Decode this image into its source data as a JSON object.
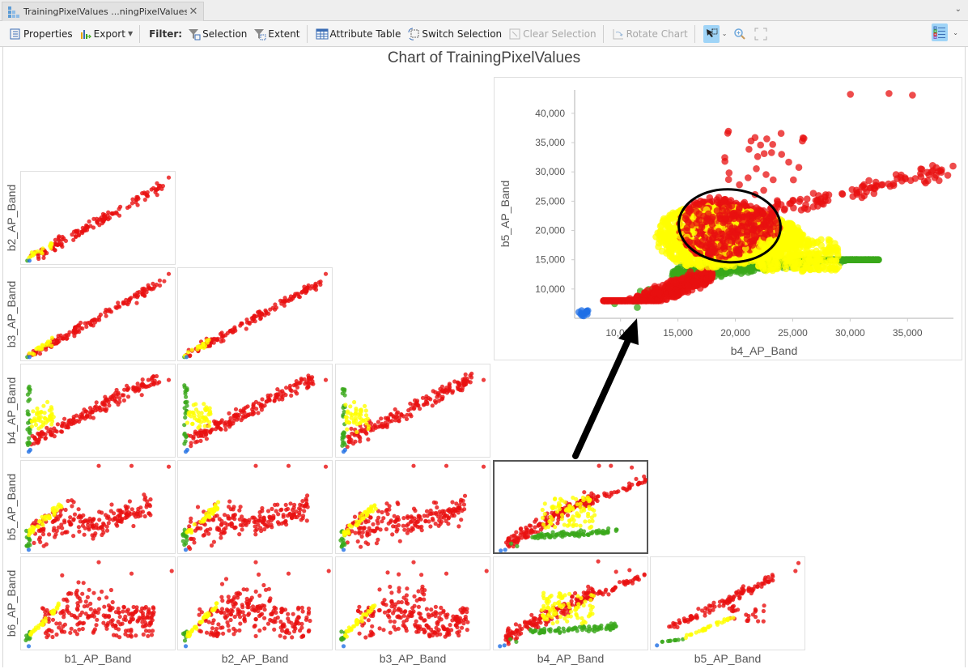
{
  "tab": {
    "label": "TrainingPixelValues ...ningPixelValues",
    "close": "✕"
  },
  "toolbar": {
    "properties": "Properties",
    "export": "Export",
    "filter_label": "Filter:",
    "selection": "Selection",
    "extent": "Extent",
    "attribute_table": "Attribute Table",
    "switch_selection": "Switch Selection",
    "clear_selection": "Clear Selection",
    "rotate_chart": "Rotate Chart"
  },
  "title": "Chart of TrainingPixelValues",
  "classes": [
    {
      "name": "class-blue",
      "color": "#1f6fe5"
    },
    {
      "name": "class-green",
      "color": "#3aa81a"
    },
    {
      "name": "class-yellow",
      "color": "#ffff00"
    },
    {
      "name": "class-red",
      "color": "#e81010"
    }
  ],
  "matrix": {
    "row_labels": [
      "b2_AP_Band",
      "b3_AP_Band",
      "b4_AP_Band",
      "b5_AP_Band",
      "b6_AP_Band"
    ],
    "col_labels": [
      "b1_AP_Band",
      "b2_AP_Band",
      "b3_AP_Band",
      "b4_AP_Band",
      "b5_AP_Band"
    ],
    "selected_cell": {
      "row": 3,
      "col": 3
    },
    "cells": [
      {
        "row": 0,
        "col": 0,
        "shape": "linear"
      },
      {
        "row": 1,
        "col": 0,
        "shape": "linear"
      },
      {
        "row": 1,
        "col": 1,
        "shape": "linear"
      },
      {
        "row": 2,
        "col": 0,
        "shape": "nir"
      },
      {
        "row": 2,
        "col": 1,
        "shape": "nir"
      },
      {
        "row": 2,
        "col": 2,
        "shape": "nir"
      },
      {
        "row": 3,
        "col": 0,
        "shape": "swir"
      },
      {
        "row": 3,
        "col": 1,
        "shape": "swir"
      },
      {
        "row": 3,
        "col": 2,
        "shape": "swir"
      },
      {
        "row": 3,
        "col": 3,
        "shape": "b4b5"
      },
      {
        "row": 4,
        "col": 0,
        "shape": "b6"
      },
      {
        "row": 4,
        "col": 1,
        "shape": "b6"
      },
      {
        "row": 4,
        "col": 2,
        "shape": "b6"
      },
      {
        "row": 4,
        "col": 3,
        "shape": "b4b6"
      },
      {
        "row": 4,
        "col": 4,
        "shape": "b5b6"
      }
    ]
  },
  "chart_data": {
    "type": "scatter",
    "title": "Chart of TrainingPixelValues",
    "xlabel": "b4_AP_Band",
    "ylabel": "b5_AP_Band",
    "xlim": [
      6000,
      39000
    ],
    "ylim": [
      5000,
      44000
    ],
    "x_ticks": [
      "10,000",
      "15,000",
      "20,000",
      "25,000",
      "30,000",
      "35,000"
    ],
    "x_tick_values": [
      10000,
      15000,
      20000,
      25000,
      30000,
      35000
    ],
    "y_ticks": [
      "10,000",
      "15,000",
      "20,000",
      "25,000",
      "30,000",
      "35,000",
      "40,000"
    ],
    "y_tick_values": [
      10000,
      15000,
      20000,
      25000,
      30000,
      35000,
      40000
    ],
    "series": [
      {
        "name": "blue",
        "color": "#1f6fe5",
        "clusters": [
          {
            "x": [
              6200,
              7200
            ],
            "y": [
              5400,
              6400
            ],
            "n": 12,
            "band": "box"
          }
        ]
      },
      {
        "name": "green",
        "color": "#3aa81a",
        "clusters": [
          {
            "x": [
              14500,
              32500
            ],
            "y": [
              9000,
              15000
            ],
            "n": 900,
            "band": "diag",
            "slope": 0.24,
            "base": 9000,
            "spread": 3200
          },
          {
            "x": [
              8500,
              13500
            ],
            "y": [
              6500,
              10000
            ],
            "n": 6,
            "band": "box"
          }
        ]
      },
      {
        "name": "yellow",
        "color": "#ffff00",
        "clusters": [
          {
            "x": [
              13500,
              28500
            ],
            "y": [
              12000,
              26000
            ],
            "n": 1100,
            "band": "blob",
            "cx": 19500,
            "cy": 19000,
            "rx": 6500,
            "ry": 5200
          },
          {
            "x": [
              22000,
              29000
            ],
            "y": [
              13000,
              18500
            ],
            "n": 250,
            "band": "box"
          }
        ]
      },
      {
        "name": "red",
        "color": "#e81010",
        "clusters": [
          {
            "x": [
              8500,
              18000
            ],
            "y": [
              8000,
              17000
            ],
            "n": 650,
            "band": "diag",
            "slope": 0.75,
            "base": -1000,
            "spread": 4200
          },
          {
            "x": [
              15000,
              24000
            ],
            "y": [
              14000,
              26000
            ],
            "n": 450,
            "band": "blob",
            "cx": 19500,
            "cy": 20500,
            "rx": 4500,
            "ry": 5000
          },
          {
            "x": [
              18000,
              39000
            ],
            "y": [
              22000,
              32000
            ],
            "n": 130,
            "band": "diag",
            "slope": 0.42,
            "base": 14000,
            "spread": 4000
          },
          {
            "x": [
              19000,
              26000
            ],
            "y": [
              26000,
              37000
            ],
            "n": 30,
            "band": "box"
          },
          {
            "x": [
              28500,
              35500
            ],
            "y": [
              43000,
              44000
            ],
            "n": 3,
            "band": "box"
          }
        ]
      }
    ],
    "annotations": [
      "ellipse around yellow/red overlap near (19500, 21000)",
      "arrow from selected matrix cell to enlarged chart"
    ]
  }
}
